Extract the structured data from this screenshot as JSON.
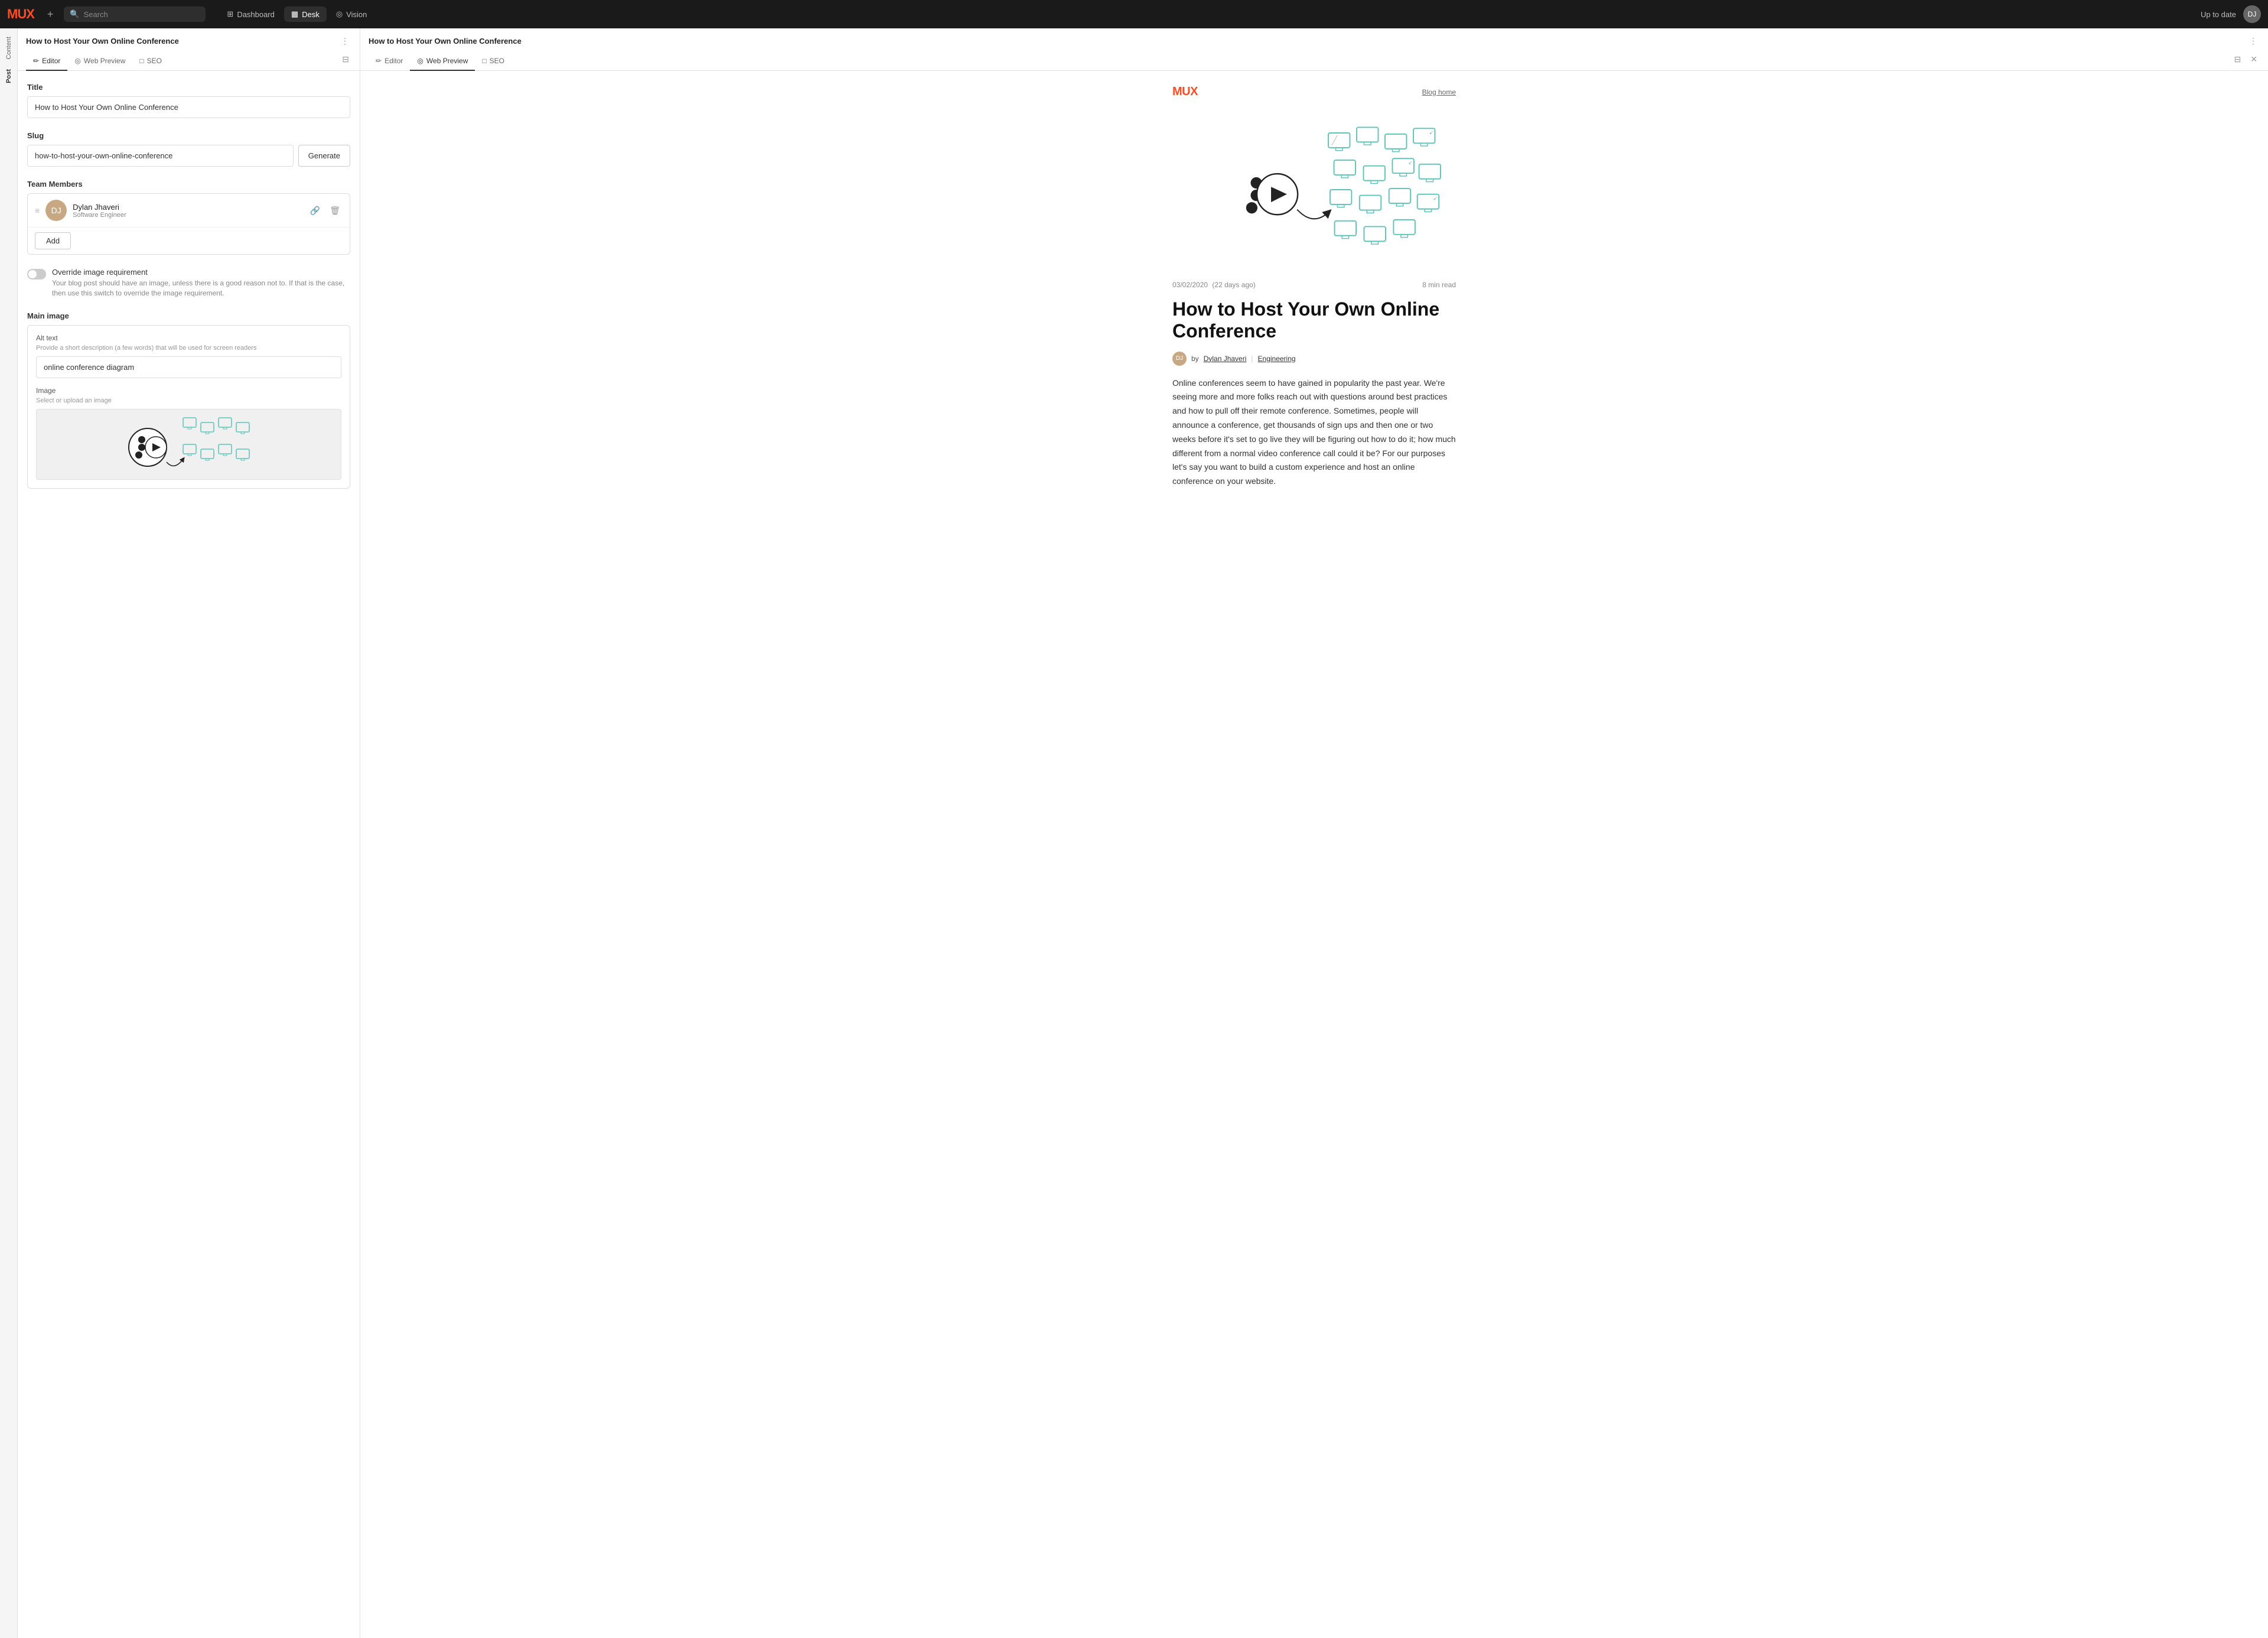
{
  "app": {
    "logo": "MUX",
    "add_btn": "+",
    "search_placeholder": "Search",
    "status": "Up to date"
  },
  "nav": {
    "links": [
      {
        "id": "dashboard",
        "label": "Dashboard",
        "icon": "⊞",
        "active": false
      },
      {
        "id": "desk",
        "label": "Desk",
        "icon": "▦",
        "active": true
      },
      {
        "id": "vision",
        "label": "Vision",
        "icon": "◎",
        "active": false
      }
    ]
  },
  "sidebar": {
    "items": [
      {
        "id": "content",
        "label": "Content",
        "active": false
      },
      {
        "id": "post",
        "label": "Post",
        "active": true
      }
    ]
  },
  "left_panel": {
    "title": "How to Host Your Own Online Conference",
    "tabs": [
      {
        "id": "editor",
        "label": "Editor",
        "icon": "✏",
        "active": true
      },
      {
        "id": "web-preview",
        "label": "Web Preview",
        "icon": "◎",
        "active": false
      },
      {
        "id": "seo",
        "label": "SEO",
        "icon": "□",
        "active": false
      }
    ],
    "fields": {
      "title_label": "Title",
      "title_value": "How to Host Your Own Online Conference",
      "slug_label": "Slug",
      "slug_value": "how-to-host-your-own-online-conference",
      "generate_btn": "Generate",
      "team_members_label": "Team Members",
      "member_name": "Dylan Jhaveri",
      "member_role": "Software Engineer",
      "add_btn": "Add",
      "override_title": "Override image requirement",
      "override_desc": "Your blog post should have an image, unless there is a good reason not to. If that is the case, then use this switch to override the image requirement.",
      "main_image_label": "Main image",
      "alt_text_label": "Alt text",
      "alt_text_hint": "Provide a short description (a few words) that will be used for screen readers",
      "alt_text_value": "online conference diagram",
      "image_label": "Image",
      "image_hint": "Select or upload an image"
    }
  },
  "right_panel": {
    "title": "How to Host Your Own Online Conference",
    "tabs": [
      {
        "id": "editor",
        "label": "Editor",
        "icon": "✏",
        "active": false
      },
      {
        "id": "web-preview",
        "label": "Web Preview",
        "icon": "◎",
        "active": true
      },
      {
        "id": "seo",
        "label": "SEO",
        "icon": "□",
        "active": false
      }
    ],
    "blog": {
      "logo": "MUX",
      "home_link": "Blog home",
      "date": "03/02/2020",
      "date_relative": "(22 days ago)",
      "read_time": "8 min read",
      "title": "How to Host Your Own Online Conference",
      "author_label": "by",
      "author_name": "Dylan Jhaveri",
      "category": "Engineering",
      "body": "Online conferences seem to have gained in popularity the past year. We're seeing more and more folks reach out with questions around best practices and how to pull off their remote conference. Sometimes, people will announce a conference, get thousands of sign ups and then one or two weeks before it's set to go live they will be figuring out how to do it; how much different from a normal video conference call could it be? For our purposes let's say you want to build a custom experience and host an online conference on your website."
    }
  }
}
